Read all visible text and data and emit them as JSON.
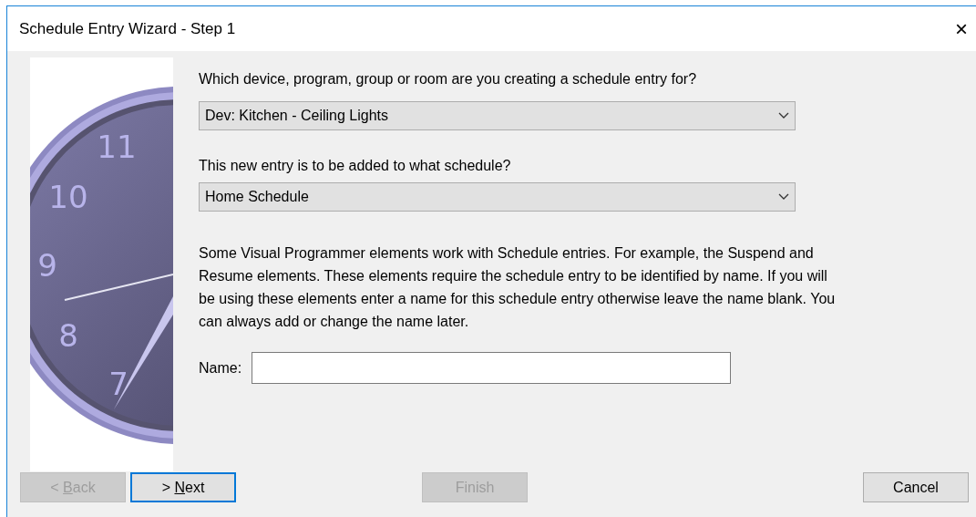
{
  "window": {
    "title": "Schedule Entry Wizard - Step 1",
    "close": "×"
  },
  "clock": {
    "numerals": [
      "11",
      "10",
      "9",
      "8",
      "7"
    ]
  },
  "device": {
    "label": "Which device, program, group or room are you creating a schedule entry for?",
    "value": "Dev: Kitchen - Ceiling Lights"
  },
  "schedule": {
    "label": "This new entry is to be added to what schedule?",
    "value": "Home Schedule"
  },
  "description": [
    "Some Visual Programmer elements work with Schedule entries.  For example, the Suspend and",
    "Resume elements.  These elements require the schedule entry to be identified by name.  If you will",
    "be using these elements enter a name for this schedule entry otherwise leave the name blank.  You",
    "can always add or change the name later."
  ],
  "name_field": {
    "label": "Name:"
  },
  "buttons": [
    {
      "label": "< ",
      "access_key": "B",
      "label_rest": "ack",
      "disabled": true,
      "focused": false
    },
    {
      "label": "> ",
      "access_key": "N",
      "label_rest": "ext",
      "disabled": false,
      "focused": true
    },
    {
      "label": "Finish",
      "disabled": true,
      "focused": false
    },
    {
      "label": "Cancel",
      "disabled": false,
      "focused": false
    }
  ]
}
